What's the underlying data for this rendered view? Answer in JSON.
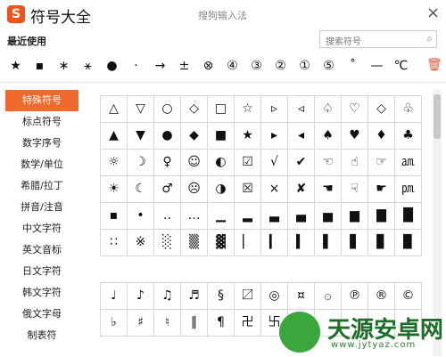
{
  "window": {
    "logo_letter": "S",
    "title": "符号大全",
    "subtitle": "搜狗输入法",
    "close_symbol": "×"
  },
  "recent": {
    "label": "最近使用",
    "symbols": [
      "★",
      "▪",
      "∗",
      "⚹",
      "●",
      "·",
      "→",
      "±",
      "⊗",
      "④",
      "③",
      "②",
      "①",
      "⑤",
      "˚",
      "—",
      "℃"
    ]
  },
  "search": {
    "placeholder": "搜索符号",
    "icon": "search-icon"
  },
  "sidebar": {
    "categories": [
      "特殊符号",
      "标点符号",
      "数字序号",
      "数学/单位",
      "希腊/拉丁",
      "拼音/注音",
      "中文字符",
      "英文音标",
      "日文字符",
      "韩文字符",
      "俄文字母",
      "制表符"
    ],
    "active": "特殊符号"
  },
  "grid1": {
    "rows": [
      [
        "△",
        "▽",
        "○",
        "◇",
        "□",
        "☆",
        "▹",
        "◃",
        "♤",
        "♡",
        "◇",
        "♧"
      ],
      [
        "▲",
        "▼",
        "●",
        "◆",
        "■",
        "★",
        "▸",
        "◂",
        "♠",
        "♥",
        "♦",
        "♣"
      ],
      [
        "☼",
        "☽",
        "♀",
        "☺",
        "◐",
        "☑",
        "√",
        "✔",
        "☜",
        "☝",
        "☞",
        "㏂"
      ],
      [
        "☀",
        "☾",
        "♂",
        "☹",
        "◑",
        "☒",
        "×",
        "✘",
        "☚",
        "☟",
        "☛",
        "㏘"
      ],
      [
        "▪",
        "•",
        "‥",
        "…",
        "▁",
        "▂",
        "▃",
        "▄",
        "▅",
        "▆",
        "▇",
        "█"
      ],
      [
        "∷",
        "※",
        "░",
        "▒",
        "▓",
        "▏",
        "▎",
        "▍",
        "▌",
        "▋",
        "▊",
        "▉"
      ]
    ]
  },
  "grid2": {
    "rows": [
      [
        "♩",
        "♪",
        "♫",
        "♬",
        "§",
        "〼",
        "◎",
        "¤",
        "۞",
        "℗",
        "®",
        "©"
      ],
      [
        "♭",
        "♯",
        "♮",
        "‖",
        "¶",
        "卍",
        "卐",
        "",
        "",
        "",
        "",
        ""
      ]
    ]
  },
  "watermark": {
    "name": "天源安卓网",
    "url": "www.jytyaz.com"
  }
}
